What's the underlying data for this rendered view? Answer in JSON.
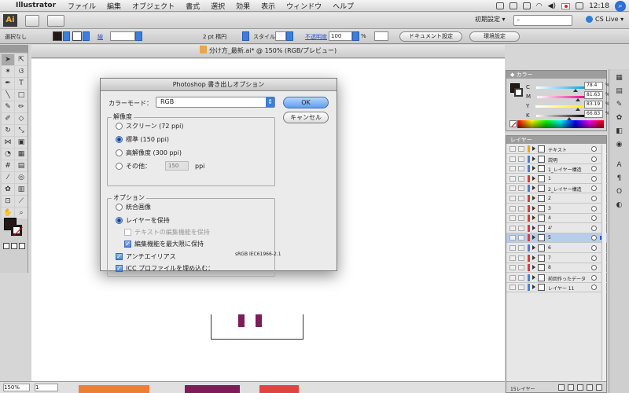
{
  "menubar": {
    "app_name": "Illustrator",
    "items": [
      "ファイル",
      "編集",
      "オブジェクト",
      "書式",
      "選択",
      "効果",
      "表示",
      "ウィンドウ",
      "ヘルプ"
    ],
    "clock": "12:18"
  },
  "appbar": {
    "logo": "Ai",
    "workspace": "初期設定 ▾",
    "search_placeholder": "",
    "cs_live": "CS Live ▾"
  },
  "controlbar": {
    "selection": "選択なし",
    "stroke_label": "線",
    "stroke_width": "",
    "brush": "2 pt 楕円",
    "style_label": "スタイル：",
    "opacity_label": "不透明度",
    "opacity_value": "100",
    "opacity_unit": "%",
    "doc_setup": "ドキュメント設定",
    "prefs": "環境設定"
  },
  "document": {
    "title": "分け方_最新.ai* @ 150% (RGB/プレビュー)"
  },
  "statusbar": {
    "zoom": "150%",
    "page": "1",
    "tool": "選択"
  },
  "dialog": {
    "title": "Photoshop 書き出しオプション",
    "color_mode_label": "カラーモード：",
    "color_mode_value": "RGB",
    "ok": "OK",
    "cancel": "キャンセル",
    "resolution": {
      "title": "解像度",
      "screen": "スクリーン (72 ppi)",
      "medium": "標準 (150 ppi)",
      "high": "高解像度 (300 ppi)",
      "other": "その他：",
      "other_value": "150",
      "other_unit": "ppi",
      "selected": "medium"
    },
    "options": {
      "title": "オプション",
      "flat": "統合画像",
      "write_layers": "レイヤーを保持",
      "text_editability": "テキストの編集機能を保持",
      "max_editability": "編集機能を最大限に保持",
      "antialias": "アンチエイリアス",
      "icc": "ICC プロファイルを埋め込む：",
      "icc_value": "sRGB IEC61966-2.1"
    }
  },
  "color_panel": {
    "title": "カラー",
    "channels": [
      {
        "label": "C",
        "value": "78.4",
        "pct": 0.784,
        "color": "#00a0e9"
      },
      {
        "label": "M",
        "value": "81.63",
        "pct": 0.816,
        "color": "#e4007f"
      },
      {
        "label": "Y",
        "value": "83.19",
        "pct": 0.832,
        "color": "#fff100"
      },
      {
        "label": "K",
        "value": "66.83",
        "pct": 0.668,
        "color": "#000000"
      }
    ],
    "unit": "%"
  },
  "layers_panel": {
    "title": "レイヤー",
    "layers": [
      {
        "name": "テキスト",
        "color": "#f7a400"
      },
      {
        "name": "説明",
        "color": "#4d7ddc"
      },
      {
        "name": "1_レイヤー構造",
        "color": "#4d7ddc"
      },
      {
        "name": "1",
        "color": "#e03b3b"
      },
      {
        "name": "2_レイヤー構造",
        "color": "#4d7ddc"
      },
      {
        "name": "2",
        "color": "#e03b3b"
      },
      {
        "name": "3",
        "color": "#e03b3b"
      },
      {
        "name": "4",
        "color": "#e03b3b"
      },
      {
        "name": "4'",
        "color": "#e03b3b"
      },
      {
        "name": "5",
        "color": "#e03b3b"
      },
      {
        "name": "6",
        "color": "#4d7ddc"
      },
      {
        "name": "7",
        "color": "#e03b3b"
      },
      {
        "name": "8",
        "color": "#e03b3b"
      },
      {
        "name": "前回作ったデータ",
        "color": "#4d7ddc"
      },
      {
        "name": "レイヤー 11",
        "color": "#4d7ddc"
      }
    ],
    "selected_index": 9,
    "count": "15レイヤー"
  }
}
